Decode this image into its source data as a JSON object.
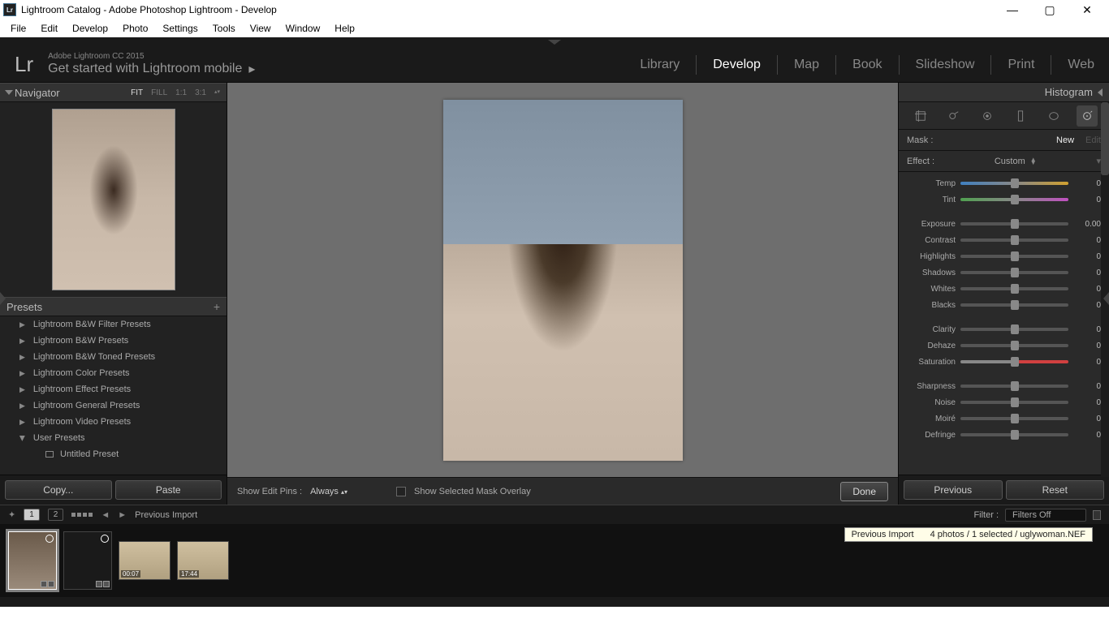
{
  "titlebar": {
    "title": "Lightroom Catalog - Adobe Photoshop Lightroom - Develop"
  },
  "menubar": [
    "File",
    "Edit",
    "Develop",
    "Photo",
    "Settings",
    "Tools",
    "View",
    "Window",
    "Help"
  ],
  "identity": {
    "logo": "Lr",
    "line1": "Adobe Lightroom CC 2015",
    "line2": "Get started with Lightroom mobile",
    "modules": [
      "Library",
      "Develop",
      "Map",
      "Book",
      "Slideshow",
      "Print",
      "Web"
    ],
    "active_module": "Develop"
  },
  "navigator": {
    "title": "Navigator",
    "zoom": [
      "FIT",
      "FILL",
      "1:1",
      "3:1"
    ],
    "zoom_active": "FIT"
  },
  "presets": {
    "title": "Presets",
    "items": [
      {
        "label": "Lightroom B&W Filter Presets",
        "expanded": false
      },
      {
        "label": "Lightroom B&W Presets",
        "expanded": false
      },
      {
        "label": "Lightroom B&W Toned Presets",
        "expanded": false
      },
      {
        "label": "Lightroom Color Presets",
        "expanded": false
      },
      {
        "label": "Lightroom Effect Presets",
        "expanded": false
      },
      {
        "label": "Lightroom General Presets",
        "expanded": false
      },
      {
        "label": "Lightroom Video Presets",
        "expanded": false
      },
      {
        "label": "User Presets",
        "expanded": true,
        "children": [
          "Untitled Preset"
        ]
      }
    ]
  },
  "copy_paste": {
    "copy": "Copy...",
    "paste": "Paste"
  },
  "center_bar": {
    "edit_pins_label": "Show Edit Pins :",
    "edit_pins_value": "Always",
    "overlay": "Show Selected Mask Overlay",
    "done": "Done"
  },
  "right": {
    "histogram": "Histogram",
    "mask": {
      "label": "Mask :",
      "new": "New",
      "edit": "Edit"
    },
    "effect": {
      "label": "Effect :",
      "value": "Custom"
    },
    "sliders": [
      {
        "label": "Temp",
        "val": "0",
        "class": "temp"
      },
      {
        "label": "Tint",
        "val": "0",
        "class": "tint"
      },
      {
        "gap": true
      },
      {
        "label": "Exposure",
        "val": "0.00"
      },
      {
        "label": "Contrast",
        "val": "0"
      },
      {
        "label": "Highlights",
        "val": "0"
      },
      {
        "label": "Shadows",
        "val": "0"
      },
      {
        "label": "Whites",
        "val": "0"
      },
      {
        "label": "Blacks",
        "val": "0"
      },
      {
        "gap": true
      },
      {
        "label": "Clarity",
        "val": "0"
      },
      {
        "label": "Dehaze",
        "val": "0"
      },
      {
        "label": "Saturation",
        "val": "0",
        "class": "sat"
      },
      {
        "gap": true
      },
      {
        "label": "Sharpness",
        "val": "0"
      },
      {
        "label": "Noise",
        "val": "0"
      },
      {
        "label": "Moiré",
        "val": "0"
      },
      {
        "label": "Defringe",
        "val": "0"
      }
    ],
    "prev": "Previous",
    "reset": "Reset"
  },
  "filmstrip_bar": {
    "screen1": "1",
    "screen2": "2",
    "path": "Previous Import",
    "filter_label": "Filter :",
    "filter_value": "Filters Off"
  },
  "filmstrip": {
    "tooltip_left": "Previous Import",
    "tooltip_right": "4 photos / 1 selected / uglywoman.NEF",
    "items": [
      {
        "kind": "portrait",
        "selected": true,
        "circle": true,
        "badges": 2
      },
      {
        "kind": "dark",
        "circle": true,
        "badges": 2
      },
      {
        "kind": "landscape",
        "time": "00:07"
      },
      {
        "kind": "landscape",
        "time": "17:44"
      }
    ]
  }
}
